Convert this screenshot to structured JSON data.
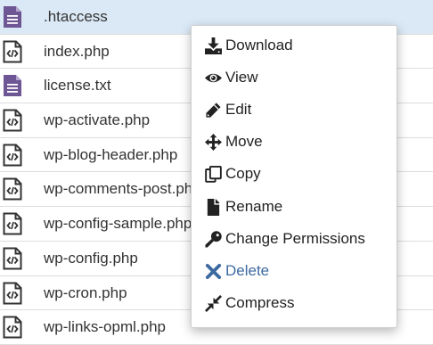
{
  "files": [
    {
      "name": ".htaccess",
      "icon": "text-file-icon",
      "selected": true
    },
    {
      "name": "index.php",
      "icon": "code-file-icon"
    },
    {
      "name": "license.txt",
      "icon": "text-file-icon"
    },
    {
      "name": "wp-activate.php",
      "icon": "code-file-icon"
    },
    {
      "name": "wp-blog-header.php",
      "icon": "code-file-icon"
    },
    {
      "name": "wp-comments-post.php",
      "icon": "code-file-icon"
    },
    {
      "name": "wp-config-sample.php",
      "icon": "code-file-icon"
    },
    {
      "name": "wp-config.php",
      "icon": "code-file-icon"
    },
    {
      "name": "wp-cron.php",
      "icon": "code-file-icon"
    },
    {
      "name": "wp-links-opml.php",
      "icon": "code-file-icon"
    }
  ],
  "context_menu": {
    "items": [
      {
        "label": "Download",
        "icon": "download-icon"
      },
      {
        "label": "View",
        "icon": "eye-icon"
      },
      {
        "label": "Edit",
        "icon": "pencil-icon"
      },
      {
        "label": "Move",
        "icon": "move-arrows-icon"
      },
      {
        "label": "Copy",
        "icon": "copy-icon"
      },
      {
        "label": "Rename",
        "icon": "rename-file-icon"
      },
      {
        "label": "Change Permissions",
        "icon": "key-icon"
      },
      {
        "label": "Delete",
        "icon": "delete-x-icon"
      },
      {
        "label": "Compress",
        "icon": "compress-icon"
      }
    ]
  },
  "colors": {
    "selected_row": "#dbe8f5",
    "text_file_icon": "#6e5694",
    "code_file_icon": "#333333",
    "delete_text": "#3d6aa0"
  }
}
